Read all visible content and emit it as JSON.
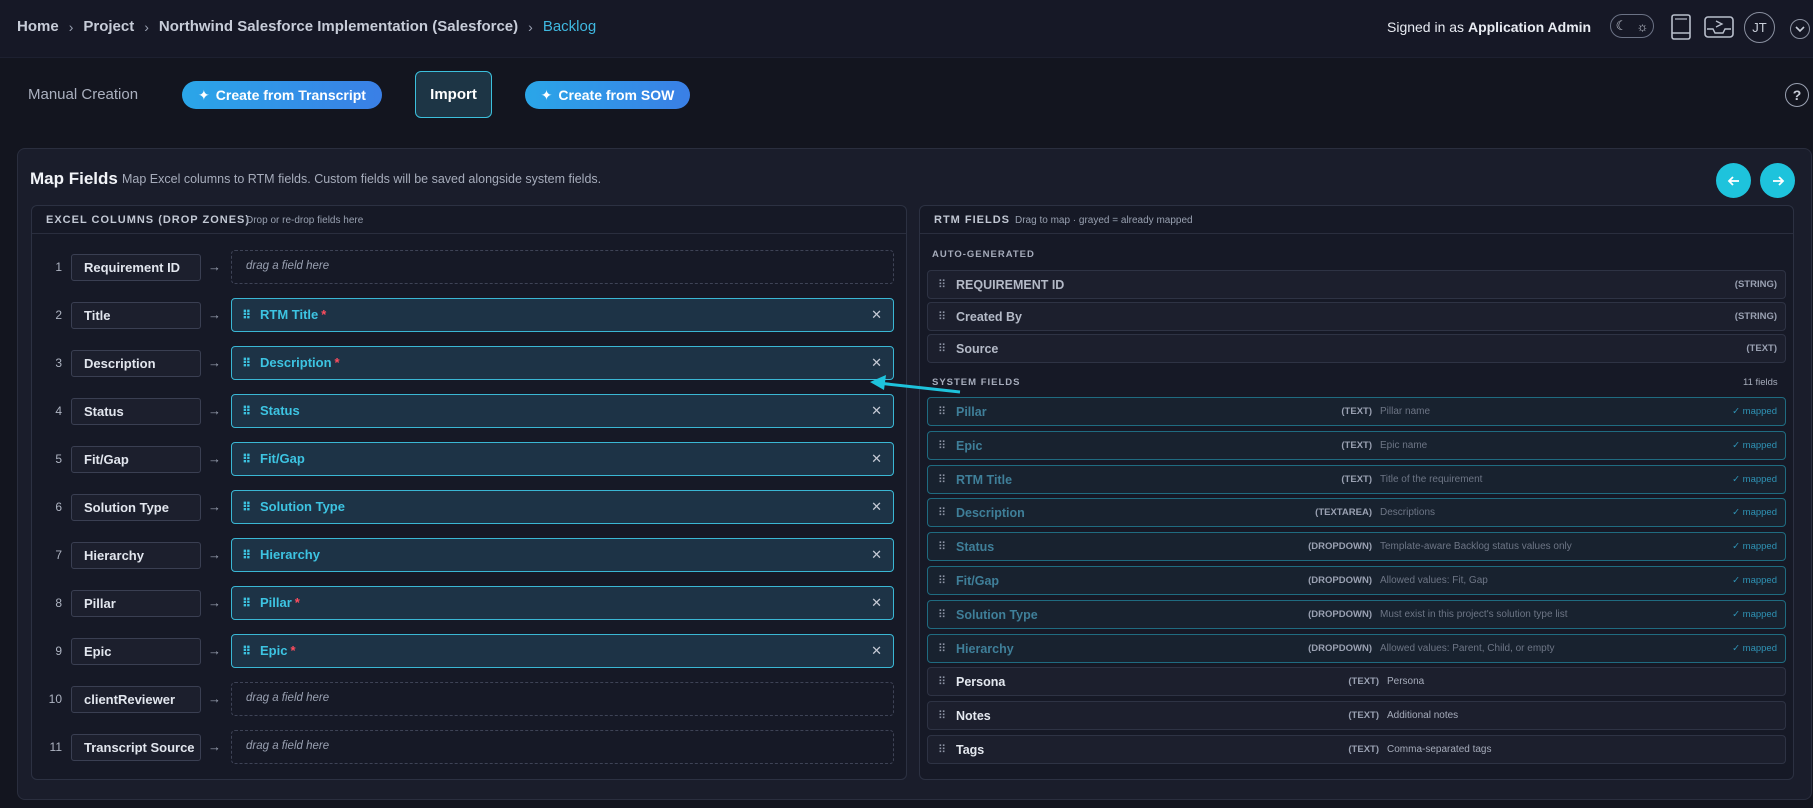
{
  "breadcrumb": {
    "home": "Home",
    "project": "Project",
    "project_name": "Northwind Salesforce Implementation (Salesforce)",
    "current": "Backlog"
  },
  "user": {
    "signed_in_prefix": "Signed in as",
    "name": "Application Admin",
    "initials": "JT"
  },
  "toolbar": {
    "manual_label": "Manual Creation",
    "transcript_label": "Create from Transcript",
    "import_label": "Import",
    "sow_label": "Create from SOW",
    "help_glyph": "?"
  },
  "map_fields": {
    "title": "Map Fields",
    "subtitle": "Map Excel columns to RTM fields. Custom fields will be saved alongside system fields."
  },
  "excel_panel": {
    "title": "EXCEL COLUMNS (DROP ZONES)",
    "subtitle": "Drop or re-drop fields here",
    "placeholder": "drag a field here",
    "rows": [
      {
        "num": "1",
        "column": "Requirement ID",
        "mapped": ""
      },
      {
        "num": "2",
        "column": "Title",
        "mapped": "RTM Title",
        "required": true
      },
      {
        "num": "3",
        "column": "Description",
        "mapped": "Description",
        "required": true
      },
      {
        "num": "4",
        "column": "Status",
        "mapped": "Status",
        "required": false
      },
      {
        "num": "5",
        "column": "Fit/Gap",
        "mapped": "Fit/Gap",
        "required": false
      },
      {
        "num": "6",
        "column": "Solution Type",
        "mapped": "Solution Type",
        "required": false
      },
      {
        "num": "7",
        "column": "Hierarchy",
        "mapped": "Hierarchy",
        "required": false
      },
      {
        "num": "8",
        "column": "Pillar",
        "mapped": "Pillar",
        "required": true
      },
      {
        "num": "9",
        "column": "Epic",
        "mapped": "Epic",
        "required": true
      },
      {
        "num": "10",
        "column": "clientReviewer",
        "mapped": ""
      },
      {
        "num": "11",
        "column": "Transcript Source",
        "mapped": ""
      }
    ]
  },
  "rtm_panel": {
    "title": "RTM FIELDS",
    "subtitle": "Drag to map · grayed = already mapped",
    "auto_section": "AUTO-GENERATED",
    "system_section": "SYSTEM FIELDS",
    "system_count": "11 fields",
    "mapped_label": "✓ mapped",
    "auto_fields": [
      {
        "name": "REQUIREMENT ID",
        "type": "(STRING)"
      },
      {
        "name": "Created By",
        "type": "(STRING)"
      },
      {
        "name": "Source",
        "type": "(TEXT)"
      }
    ],
    "system_fields": [
      {
        "name": "Pillar",
        "type": "(TEXT)",
        "desc": "Pillar name",
        "mapped": true
      },
      {
        "name": "Epic",
        "type": "(TEXT)",
        "desc": "Epic name",
        "mapped": true
      },
      {
        "name": "RTM Title",
        "type": "(TEXT)",
        "desc": "Title of the requirement",
        "mapped": true
      },
      {
        "name": "Description",
        "type": "(TEXTAREA)",
        "desc": "Descriptions",
        "mapped": true
      },
      {
        "name": "Status",
        "type": "(DROPDOWN)",
        "desc": "Template-aware Backlog status values only",
        "mapped": true
      },
      {
        "name": "Fit/Gap",
        "type": "(DROPDOWN)",
        "desc": "Allowed values: Fit, Gap",
        "mapped": true
      },
      {
        "name": "Solution Type",
        "type": "(DROPDOWN)",
        "desc": "Must exist in this project's solution type list",
        "mapped": true
      },
      {
        "name": "Hierarchy",
        "type": "(DROPDOWN)",
        "desc": "Allowed values: Parent, Child, or empty",
        "mapped": true
      },
      {
        "name": "Persona",
        "type": "(TEXT)",
        "desc": "Persona",
        "mapped": false
      },
      {
        "name": "Notes",
        "type": "(TEXT)",
        "desc": "Additional notes",
        "mapped": false
      },
      {
        "name": "Tags",
        "type": "(TEXT)",
        "desc": "Comma-separated tags",
        "mapped": false
      }
    ]
  },
  "colors": {
    "accent": "#1ec3dc",
    "link": "#3fb8e0",
    "required": "#ff4d5e",
    "background": "#13151f"
  }
}
